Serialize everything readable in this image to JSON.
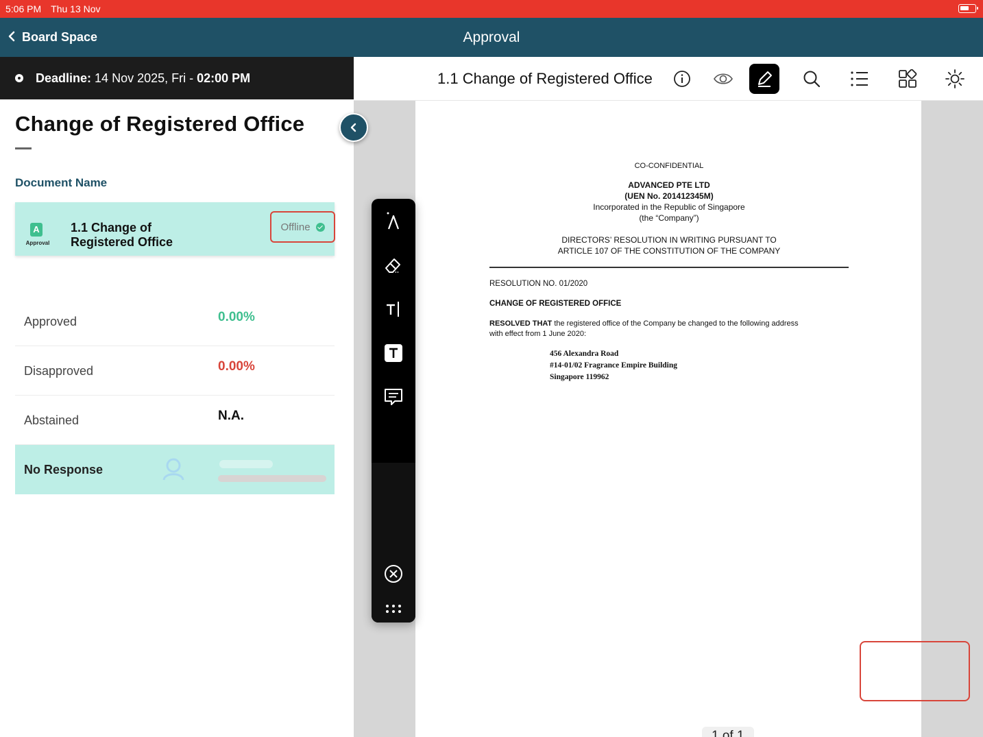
{
  "status_bar": {
    "time": "5:06 PM",
    "date": "Thu 13 Nov"
  },
  "nav": {
    "back_label": "Board Space",
    "title": "Approval"
  },
  "deadline": {
    "label": "Deadline:",
    "date": "14 Nov 2025, Fri -",
    "time": "02:00 PM"
  },
  "toolbar": {
    "doc_title": "1.1 Change of Registered Office",
    "icons": [
      "info-icon",
      "eye-icon",
      "pen-icon",
      "search-icon",
      "list-icon",
      "grid-icon",
      "brightness-icon"
    ],
    "active_icon": "pen-icon"
  },
  "left_panel": {
    "heading": "Change of Registered Office",
    "section_label": "Document Name",
    "document": {
      "icon_letter": "A",
      "icon_label": "Approval",
      "name": "1.1 Change of Registered Office",
      "status": "Offline"
    },
    "stats": [
      {
        "label": "Approved",
        "value": "0.00%",
        "color": "#3fbf8f"
      },
      {
        "label": "Disapproved",
        "value": "0.00%",
        "color": "#d8453a"
      },
      {
        "label": "Abstained",
        "value": "N.A.",
        "color": "#111111"
      }
    ],
    "no_response": {
      "label": "No Response"
    }
  },
  "annotation_toolbar": {
    "tools": [
      "pen-tool-icon",
      "eraser-icon",
      "text-cursor-icon",
      "text-box-icon",
      "comment-icon"
    ],
    "close": "close-circle-icon",
    "more": "more-dots-icon"
  },
  "document": {
    "confidential": "CO-CONFIDENTIAL",
    "company": "ADVANCED PTE LTD",
    "uen": "(UEN No. 201412345M)",
    "incorporated": "Incorporated in the Republic of Singapore",
    "company_alias": "(the “Company”)",
    "resolution_title_1": "DIRECTORS’ RESOLUTION IN WRITING PURSUANT TO",
    "resolution_title_2": "ARTICLE 107 OF THE CONSTITUTION OF THE COMPANY",
    "resolution_no": "RESOLUTION NO. 01/2020",
    "subject": "CHANGE OF REGISTERED OFFICE",
    "resolved_lead": "RESOLVED THAT",
    "resolved_text_1": " the registered office of the Company be changed to the following address",
    "resolved_text_2": "with effect from 1 June 2020:",
    "address_1": "456 Alexandra Road",
    "address_2": "#14-01/02 Fragrance Empire Building",
    "address_3": "Singapore 119962"
  },
  "pagination": {
    "label": "1 of 1"
  },
  "accent_colors": {
    "header": "#1f5166",
    "status_bar": "#e8362b",
    "card": "#bdeee6",
    "highlight": "#d8453a"
  }
}
